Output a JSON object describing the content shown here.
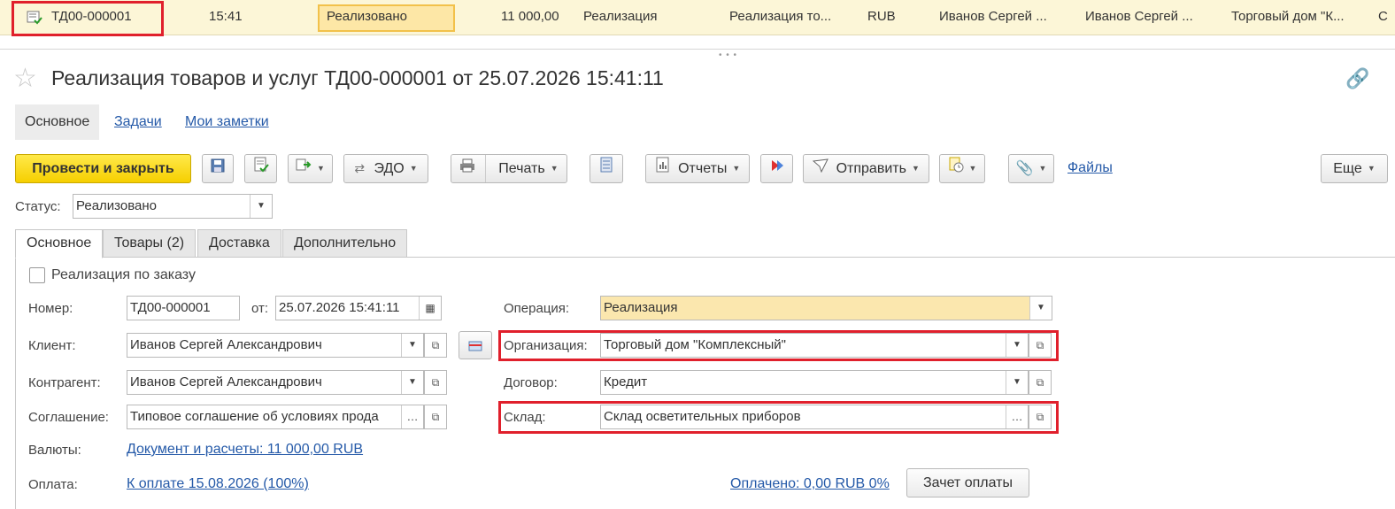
{
  "list_row": {
    "number": "ТД00-000001",
    "time": "15:41",
    "status": "Реализовано",
    "amount": "11 000,00",
    "operation": "Реализация",
    "doc_type": "Реализация то...",
    "currency": "RUB",
    "client": "Иванов Сергей ...",
    "partner": "Иванов Сергей ...",
    "organization": "Торговый дом \"К...",
    "extra": "С"
  },
  "header": {
    "title": "Реализация товаров и услуг ТД00-000001 от 25.07.2026 15:41:11"
  },
  "nav_tabs": [
    "Основное",
    "Задачи",
    "Мои заметки"
  ],
  "toolbar": {
    "post_close": "Провести и закрыть",
    "edo": "ЭДО",
    "print": "Печать",
    "reports": "Отчеты",
    "send": "Отправить",
    "files": "Файлы",
    "more": "Еще"
  },
  "status": {
    "label": "Статус:",
    "value": "Реализовано"
  },
  "form_tabs": [
    "Основное",
    "Товары (2)",
    "Доставка",
    "Дополнительно"
  ],
  "form": {
    "by_order_label": "Реализация по заказу",
    "number_label": "Номер:",
    "number_value": "ТД00-000001",
    "date_label": "от:",
    "date_value": "25.07.2026 15:41:11",
    "client_label": "Клиент:",
    "client_value": "Иванов Сергей Александрович",
    "counterparty_label": "Контрагент:",
    "counterparty_value": "Иванов Сергей Александрович",
    "agreement_label": "Соглашение:",
    "agreement_value": "Типовое соглашение об условиях прода",
    "currency_label": "Валюты:",
    "currency_link": "Документ и расчеты: 11 000,00 RUB",
    "payment_label": "Оплата:",
    "payment_link": "К оплате 15.08.2026 (100%)",
    "operation_label": "Операция:",
    "operation_value": "Реализация",
    "organization_label": "Организация:",
    "organization_value": "Торговый дом \"Комплексный\"",
    "contract_label": "Договор:",
    "contract_value": "Кредит",
    "warehouse_label": "Склад:",
    "warehouse_value": "Склад осветительных приборов",
    "paid_link": "Оплачено: 0,00 RUB 0%",
    "offset_button": "Зачет оплаты"
  },
  "colors": {
    "highlight_frame": "#e0202c",
    "accent_yellow": "#f6cf00",
    "link": "#2459a8"
  }
}
